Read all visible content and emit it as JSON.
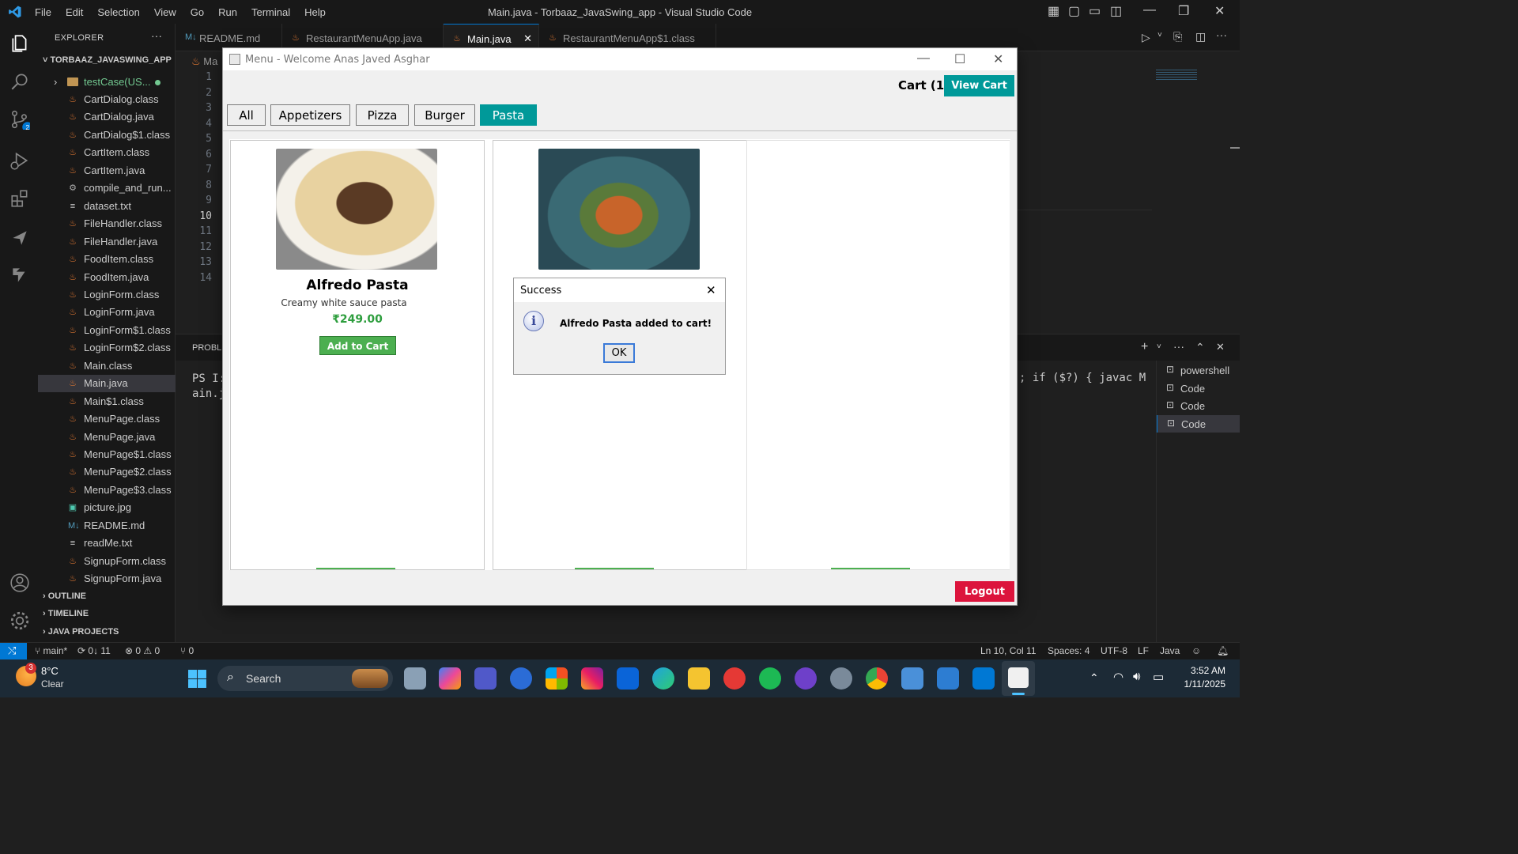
{
  "window": {
    "title": "Main.java - Torbaaz_JavaSwing_app - Visual Studio Code",
    "menu": [
      "File",
      "Edit",
      "Selection",
      "View",
      "Go",
      "Run",
      "Terminal",
      "Help"
    ]
  },
  "explorer": {
    "title": "EXPLORER",
    "project": "TORBAAZ_JAVASWING_APP",
    "folder": "testCase(US...",
    "files": [
      "CartDialog.class",
      "CartDialog.java",
      "CartDialog$1.class",
      "CartItem.class",
      "CartItem.java",
      "compile_and_run...",
      "dataset.txt",
      "FileHandler.class",
      "FileHandler.java",
      "FoodItem.class",
      "FoodItem.java",
      "LoginForm.class",
      "LoginForm.java",
      "LoginForm$1.class",
      "LoginForm$2.class",
      "Main.class",
      "Main.java",
      "Main$1.class",
      "MenuPage.class",
      "MenuPage.java",
      "MenuPage$1.class",
      "MenuPage$2.class",
      "MenuPage$3.class",
      "picture.jpg",
      "README.md",
      "readMe.txt",
      "SignupForm.class",
      "SignupForm.java"
    ],
    "sections": [
      "OUTLINE",
      "TIMELINE",
      "JAVA PROJECTS"
    ]
  },
  "tabs": [
    "README.md",
    "RestaurantMenuApp.java",
    "Main.java",
    "RestaurantMenuApp$1.class"
  ],
  "breadcrumb": "Ma",
  "line_numbers": [
    "1",
    "2",
    "3",
    "4",
    "5",
    "6",
    "7",
    "8",
    "9",
    "10",
    "11",
    "12",
    "13",
    "14"
  ],
  "panel": {
    "tab": "PROBLE",
    "terminal_line1": "PS I:",
    "terminal_line2": "ain.j",
    "terminal_right": "; if ($?) { javac M",
    "terminals": [
      "powershell",
      "Code",
      "Code",
      "Code"
    ]
  },
  "status": {
    "branch": "main*",
    "sync": "0↓ 11",
    "problems": "⊗ 0 ⚠ 0",
    "ports": "⑂ 0",
    "position": "Ln 10, Col 11",
    "spaces": "Spaces: 4",
    "encoding": "UTF-8",
    "eol": "LF",
    "language": "Java"
  },
  "taskbar": {
    "weather_temp": "8°C",
    "weather_desc": "Clear",
    "weather_badge": "3",
    "search": "Search",
    "time": "3:52 AM",
    "date": "1/11/2025"
  },
  "app": {
    "title": "Menu - Welcome Anas Javed Asghar",
    "cart_label": "Cart (1)",
    "view_cart": "View Cart",
    "categories": [
      "All",
      "Appetizers",
      "Pizza",
      "Burger",
      "Pasta"
    ],
    "selected_category": "Pasta",
    "item": {
      "name": "Alfredo Pasta",
      "desc": "Creamy white sauce pasta",
      "price": "₹249.00",
      "add_label": "Add to Cart"
    },
    "logout": "Logout"
  },
  "dialog": {
    "title": "Success",
    "message": "Alfredo Pasta added to cart!",
    "ok": "OK"
  },
  "colors": {
    "accent": "#009999",
    "vscode_blue": "#0078d4",
    "logout": "#dc143c",
    "add_green": "#4caf50",
    "price": "#2e9e3e"
  }
}
